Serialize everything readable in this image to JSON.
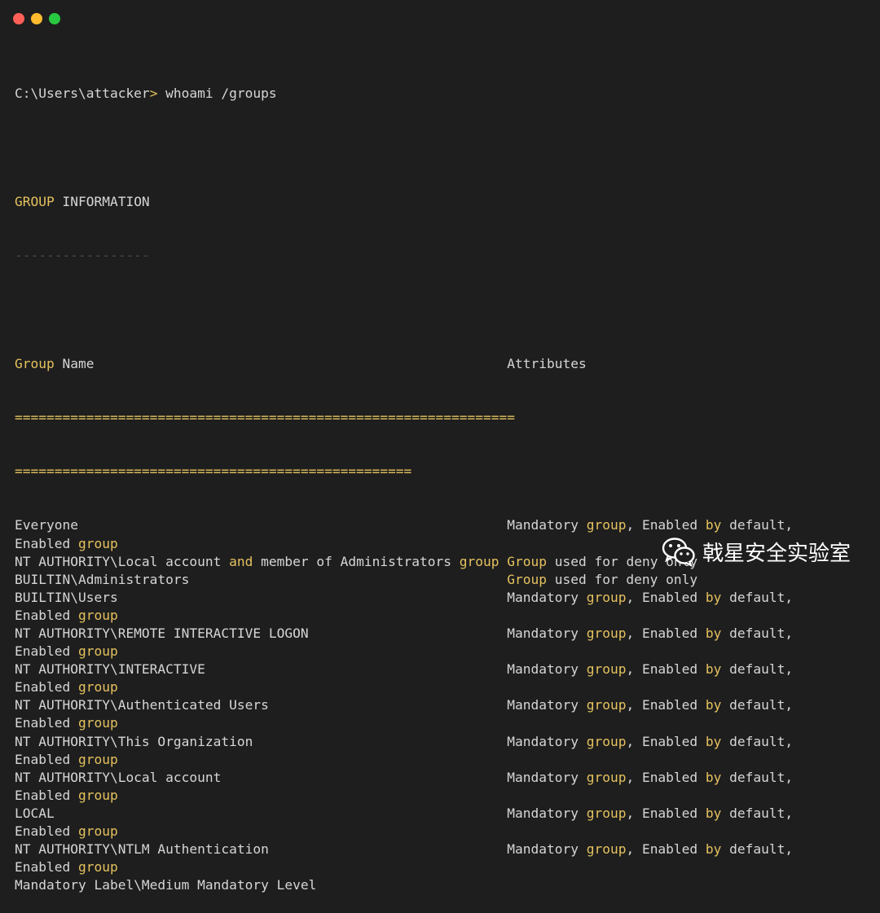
{
  "window": {
    "buttons": [
      "close",
      "minimize",
      "maximize"
    ],
    "colors": {
      "close": "#fe5f57",
      "minimize": "#febc2e",
      "maximize": "#28c840",
      "background": "#1e1e1f",
      "keyword": "#e5c25d"
    }
  },
  "prompt": {
    "path": "C:\\Users\\attacker",
    "symbol": ">",
    "command": " whoami /groups"
  },
  "header": {
    "group_word": "GROUP",
    "info_word": " INFORMATION",
    "underline": "-----------------"
  },
  "table_header": {
    "group_word": "Group",
    "name_word": " Name",
    "attributes": "Attributes",
    "separator_1": "===============================================================",
    "separator_2": "=================================================="
  },
  "rows": [
    {
      "name": "Everyone",
      "attr": [
        "Mandatory ",
        "group",
        ", Enabled ",
        "by",
        " default,"
      ],
      "cont": [
        "Enabled ",
        "group"
      ]
    },
    {
      "name_parts": [
        "NT AUTHORITY\\Local account ",
        "and",
        " member of Administrators ",
        "group"
      ],
      "attr": [
        "",
        "Group",
        " used for deny only"
      ]
    },
    {
      "name": "BUILTIN\\Administrators",
      "attr": [
        "",
        "Group",
        " used for deny only"
      ]
    },
    {
      "name": "BUILTIN\\Users",
      "attr": [
        "Mandatory ",
        "group",
        ", Enabled ",
        "by",
        " default,"
      ],
      "cont": [
        "Enabled ",
        "group"
      ]
    },
    {
      "name": "NT AUTHORITY\\REMOTE INTERACTIVE LOGON",
      "attr": [
        "Mandatory ",
        "group",
        ", Enabled ",
        "by",
        " default,"
      ],
      "cont": [
        "Enabled ",
        "group"
      ]
    },
    {
      "name": "NT AUTHORITY\\INTERACTIVE",
      "attr": [
        "Mandatory ",
        "group",
        ", Enabled ",
        "by",
        " default,"
      ],
      "cont": [
        "Enabled ",
        "group"
      ]
    },
    {
      "name": "NT AUTHORITY\\Authenticated Users",
      "attr": [
        "Mandatory ",
        "group",
        ", Enabled ",
        "by",
        " default,"
      ],
      "cont": [
        "Enabled ",
        "group"
      ]
    },
    {
      "name": "NT AUTHORITY\\This Organization",
      "attr": [
        "Mandatory ",
        "group",
        ", Enabled ",
        "by",
        " default,"
      ],
      "cont": [
        "Enabled ",
        "group"
      ]
    },
    {
      "name": "NT AUTHORITY\\Local account",
      "attr": [
        "Mandatory ",
        "group",
        ", Enabled ",
        "by",
        " default,"
      ],
      "cont": [
        "Enabled ",
        "group"
      ]
    },
    {
      "name": "LOCAL",
      "attr": [
        "Mandatory ",
        "group",
        ", Enabled ",
        "by",
        " default,"
      ],
      "cont": [
        "Enabled ",
        "group"
      ]
    },
    {
      "name": "NT AUTHORITY\\NTLM Authentication",
      "attr": [
        "Mandatory ",
        "group",
        ", Enabled ",
        "by",
        " default,"
      ],
      "cont": [
        "Enabled ",
        "group"
      ]
    },
    {
      "name": "Mandatory Label\\Medium Mandatory Level"
    }
  ],
  "watermark": {
    "icon": "wechat-icon",
    "text": "戟星安全实验室"
  }
}
